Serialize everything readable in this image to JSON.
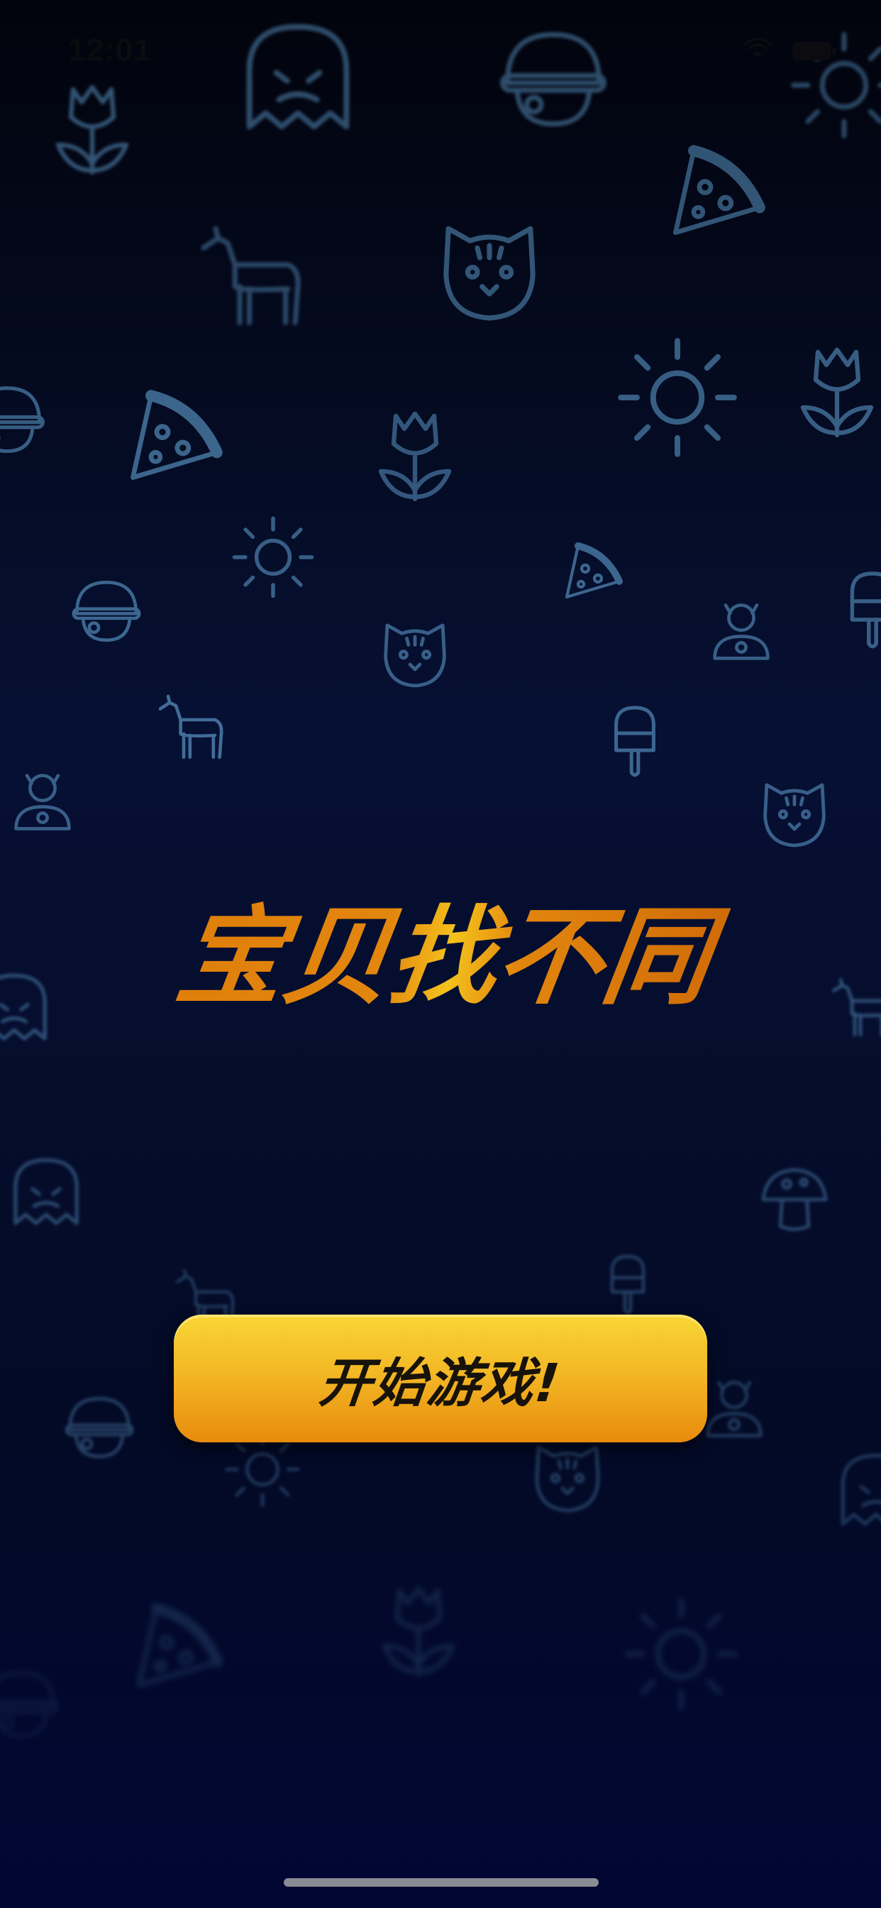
{
  "status_bar": {
    "time": "12:01"
  },
  "game": {
    "title": "宝贝找不同",
    "start_button_label": "开始游戏!"
  },
  "colors": {
    "background_top": "#02030c",
    "background_bottom": "#010733",
    "pattern_icon": "#5a95c4",
    "title_orange": "#e07f0c",
    "title_yellow": "#f4c21c",
    "button_top": "#f8d635",
    "button_bottom": "#e88b0d",
    "button_text": "#17120a"
  },
  "background_pattern_icons": [
    "tulip-icon",
    "cat-icon",
    "pizza-icon",
    "horse-icon",
    "sun-icon",
    "helmet-icon",
    "ice-cream-icon",
    "mushroom-icon",
    "flower-icon",
    "ghost-icon"
  ]
}
